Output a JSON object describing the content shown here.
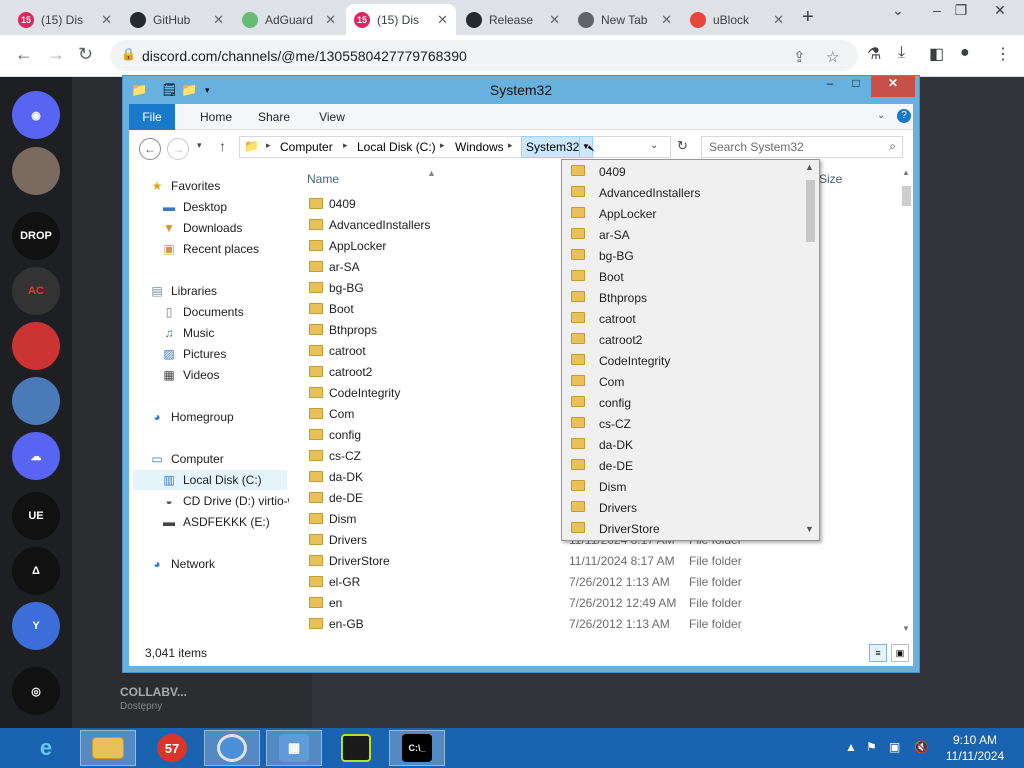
{
  "browser": {
    "tabs": [
      {
        "title": "(15) Dis",
        "badge": "15",
        "icon": "discord-icon",
        "color": "#e0245e"
      },
      {
        "title": "GitHub",
        "icon": "github-icon",
        "color": "#24292f"
      },
      {
        "title": "AdGuard",
        "icon": "adguard-shield-icon",
        "color": "#68bc71"
      },
      {
        "title": "(15) Dis",
        "badge": "15",
        "icon": "discord-icon",
        "color": "#e0245e"
      },
      {
        "title": "Release",
        "icon": "github-icon",
        "color": "#24292f"
      },
      {
        "title": "New Tab",
        "icon": "chrome-icon",
        "color": "#5f6368"
      },
      {
        "title": "uBlock",
        "icon": "rainbow-icon",
        "color": "#e8453c"
      }
    ],
    "active_tab_index": 3,
    "url": "discord.com/channels/@me/1305580427779768390"
  },
  "explorer": {
    "title": "System32",
    "ribbon_tabs": [
      "File",
      "Home",
      "Share",
      "View"
    ],
    "breadcrumb": [
      "Computer",
      "Local Disk (C:)",
      "Windows",
      "System32"
    ],
    "search_placeholder": "Search System32",
    "columns": {
      "name": "Name",
      "size": "Size"
    },
    "nav": {
      "favorites": "Favorites",
      "favorites_items": [
        "Desktop",
        "Downloads",
        "Recent places"
      ],
      "libraries": "Libraries",
      "libraries_items": [
        "Documents",
        "Music",
        "Pictures",
        "Videos"
      ],
      "homegroup": "Homegroup",
      "computer": "Computer",
      "computer_items": [
        "Local Disk (C:)",
        "CD Drive (D:) virtio-w",
        "ASDFEKKK (E:)"
      ],
      "network": "Network"
    },
    "files": [
      {
        "name": "0409",
        "date": "",
        "type": ""
      },
      {
        "name": "AdvancedInstallers",
        "date": "",
        "type": ""
      },
      {
        "name": "AppLocker",
        "date": "",
        "type": ""
      },
      {
        "name": "ar-SA",
        "date": "",
        "type": ""
      },
      {
        "name": "bg-BG",
        "date": "",
        "type": ""
      },
      {
        "name": "Boot",
        "date": "",
        "type": ""
      },
      {
        "name": "Bthprops",
        "date": "",
        "type": ""
      },
      {
        "name": "catroot",
        "date": "",
        "type": ""
      },
      {
        "name": "catroot2",
        "date": "",
        "type": ""
      },
      {
        "name": "CodeIntegrity",
        "date": "",
        "type": ""
      },
      {
        "name": "Com",
        "date": "",
        "type": ""
      },
      {
        "name": "config",
        "date": "",
        "type": ""
      },
      {
        "name": "cs-CZ",
        "date": "",
        "type": ""
      },
      {
        "name": "da-DK",
        "date": "",
        "type": ""
      },
      {
        "name": "de-DE",
        "date": "",
        "type": ""
      },
      {
        "name": "Dism",
        "date": "",
        "type": ""
      },
      {
        "name": "Drivers",
        "date": "11/11/2024 8:17 AM",
        "type": "File folder"
      },
      {
        "name": "DriverStore",
        "date": "11/11/2024 8:17 AM",
        "type": "File folder"
      },
      {
        "name": "el-GR",
        "date": "7/26/2012 1:13 AM",
        "type": "File folder"
      },
      {
        "name": "en",
        "date": "7/26/2012 12:49 AM",
        "type": "File folder"
      },
      {
        "name": "en-GB",
        "date": "7/26/2012 1:13 AM",
        "type": "File folder"
      }
    ],
    "dropdown_items": [
      "0409",
      "AdvancedInstallers",
      "AppLocker",
      "ar-SA",
      "bg-BG",
      "Boot",
      "Bthprops",
      "catroot",
      "catroot2",
      "CodeIntegrity",
      "Com",
      "config",
      "cs-CZ",
      "da-DK",
      "de-DE",
      "Dism",
      "Drivers",
      "DriverStore"
    ],
    "status": "3,041 items"
  },
  "discord": {
    "user": "COLLABV...",
    "user_status": "Dostępny"
  },
  "taskbar": {
    "apps": [
      "ie-icon",
      "file-explorer-icon",
      "badge-57-icon",
      "chrome-icon",
      "control-panel-icon",
      "notepad-icon",
      "cmd-icon"
    ],
    "badge_number": "57",
    "time": "9:10 AM",
    "date": "11/11/2024"
  }
}
